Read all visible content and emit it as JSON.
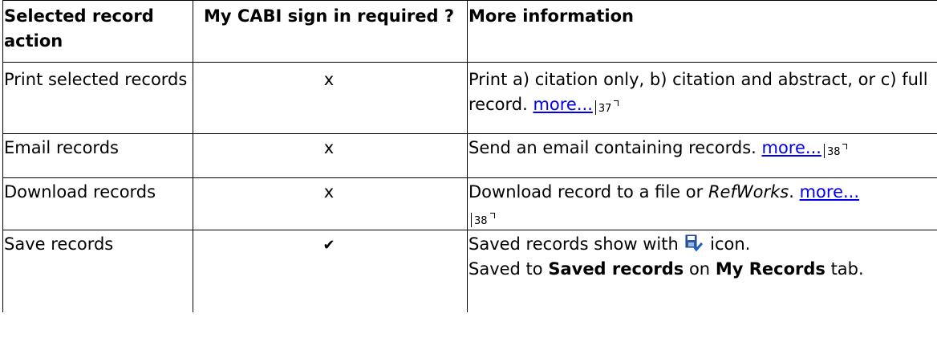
{
  "header": {
    "col1": "Selected record action",
    "col2": "My CABI sign in required ?",
    "col3": "More information"
  },
  "rows": [
    {
      "action": "Print selected records",
      "required": "x",
      "info_text": "Print a) citation only, b) citation and abstract, or c) full record.",
      "link": "more...",
      "page": "37"
    },
    {
      "action": "Email records",
      "required": "x",
      "info_text": "Send an email containing records.",
      "link": "more...",
      "page": "38"
    },
    {
      "action": "Download records",
      "required": "x",
      "info_text_before": "Download record to a file or",
      "info_italic": "RefWorks",
      "info_text_after": ".",
      "link": "more...",
      "page": "38"
    },
    {
      "action": "Save records",
      "required": "✔",
      "line1_before": "Saved records show with",
      "line1_icon": "saved-record-icon",
      "line1_after": "icon.",
      "line2_a": "Saved to",
      "line2_b": "Saved records",
      "line2_c": "on",
      "line2_d": "My Records",
      "line2_e": "tab."
    }
  ],
  "colors": {
    "link": "#0000ee",
    "icon_blue": "#2a5aa8",
    "icon_check": "#1f5fb5"
  }
}
